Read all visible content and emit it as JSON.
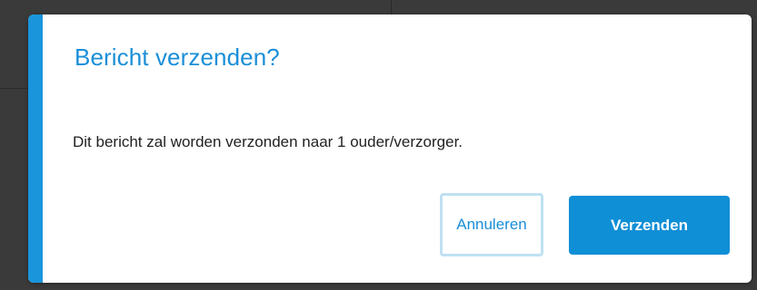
{
  "dialog": {
    "title": "Bericht verzenden?",
    "message": "Dit bericht zal worden verzonden naar 1 ouder/verzorger.",
    "cancel_label": "Annuleren",
    "confirm_label": "Verzenden"
  },
  "colors": {
    "accent": "#1a95db",
    "title": "#1a8fd8",
    "primary_button": "#0f8fd6",
    "cancel_focus_border": "#bfe0f3",
    "backdrop": "#3a3a3a"
  }
}
